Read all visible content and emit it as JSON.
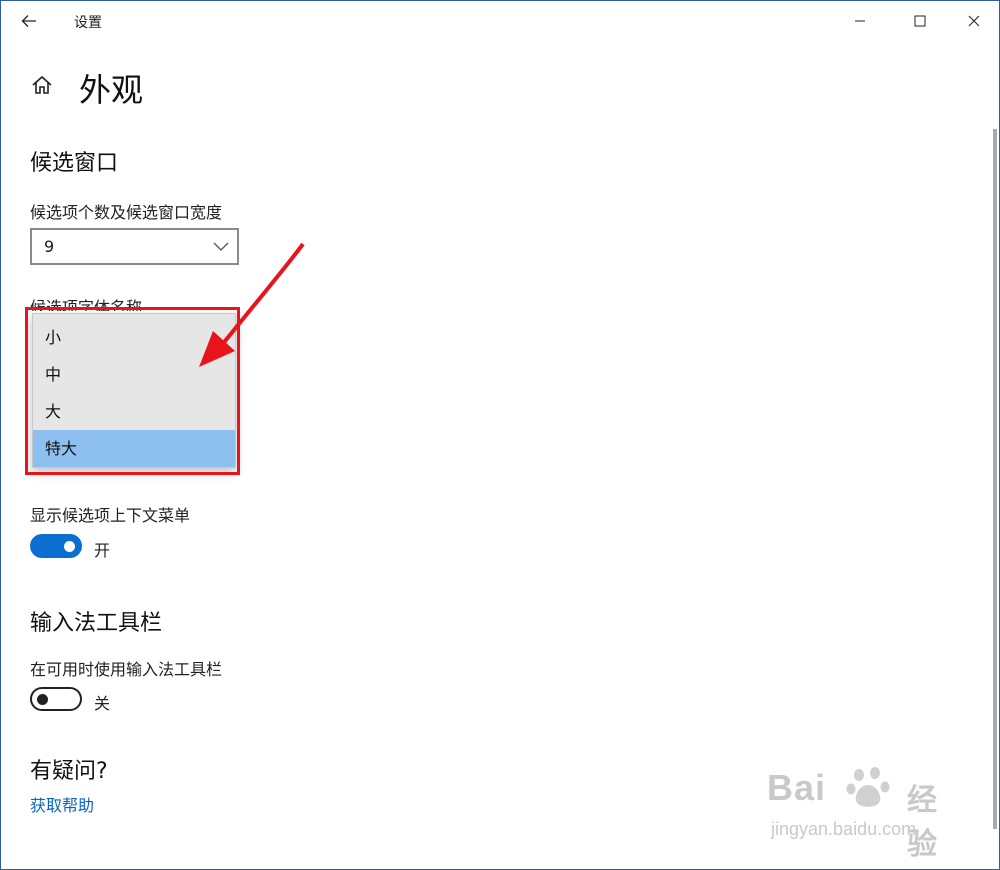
{
  "window": {
    "title": "设置"
  },
  "page": {
    "title": "外观"
  },
  "candidate_window": {
    "section_title": "候选窗口",
    "count_label": "候选项个数及候选窗口宽度",
    "count_value": "9",
    "font_label": "候选项字体名称",
    "size_options": [
      "小",
      "中",
      "大",
      "特大"
    ],
    "selected_size": "特大"
  },
  "context_menu": {
    "label": "显示候选项上下文菜单",
    "state": "开",
    "enabled": true
  },
  "toolbar": {
    "section_title": "输入法工具栏",
    "label": "在可用时使用输入法工具栏",
    "state": "关",
    "enabled": false
  },
  "help": {
    "title": "有疑问?",
    "link": "获取帮助"
  },
  "watermark": {
    "main": "Bai",
    "suffix": "经验",
    "sub": "jingyan.baidu.com"
  },
  "colors": {
    "accent": "#0a6fd0",
    "selected_item": "#8ec0ef",
    "highlight": "#e8141b",
    "link": "#0a64c2"
  }
}
